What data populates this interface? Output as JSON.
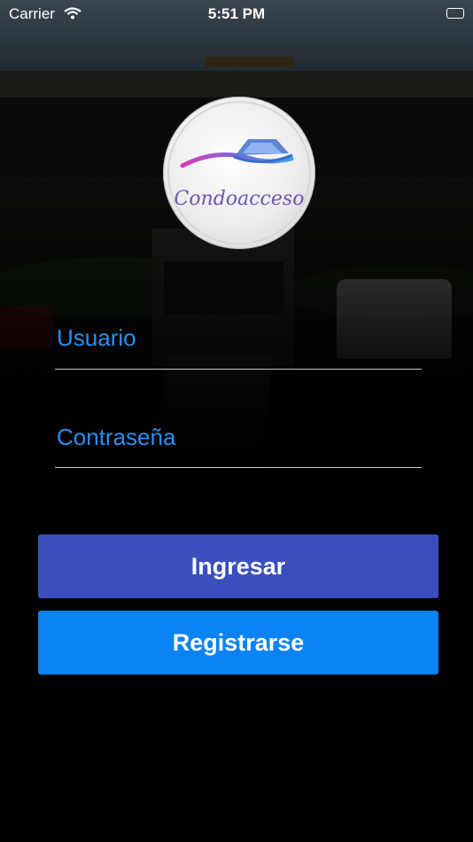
{
  "status_bar": {
    "carrier": "Carrier",
    "time": "5:51 PM"
  },
  "logo": {
    "text": "Condoacceso"
  },
  "form": {
    "username_label": "Usuario",
    "password_label": "Contraseña"
  },
  "buttons": {
    "login_label": "Ingresar",
    "register_label": "Registrarse"
  },
  "colors": {
    "field_label": "#2a8ff0",
    "login_button": "#3a4fbd",
    "register_button": "#0b83f5",
    "logo_text": "#6f55b5"
  }
}
